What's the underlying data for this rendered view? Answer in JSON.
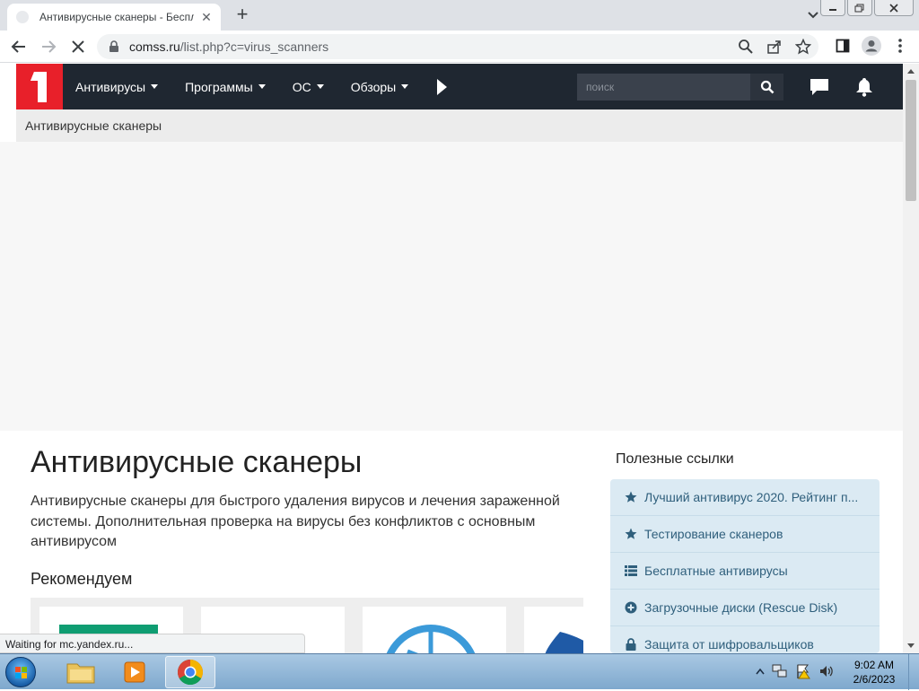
{
  "browser": {
    "tab_title": "Антивирусные сканеры - Беспл",
    "tab_close": "✕",
    "new_tab": "+",
    "url_host": "comss.ru",
    "url_path": "/list.php?c=virus_scanners"
  },
  "site": {
    "logo_text": "1",
    "nav": [
      "Антивирусы",
      "Программы",
      "ОС",
      "Обзоры"
    ],
    "search_placeholder": "поиск",
    "breadcrumb": "Антивирусные сканеры"
  },
  "content": {
    "title": "Антивирусные сканеры",
    "description": "Антивирусные сканеры для быстрого удаления вирусов и лечения зараженной системы. Дополнительная проверка на вирусы без конфликтов с основным антивирусом",
    "recommend_heading": "Рекомендуем"
  },
  "sidebar": {
    "title": "Полезные ссылки",
    "links": [
      {
        "icon": "star-icon",
        "label": "Лучший антивирус 2020. Рейтинг п..."
      },
      {
        "icon": "star-icon",
        "label": "Тестирование сканеров"
      },
      {
        "icon": "list-icon",
        "label": "Бесплатные антивирусы"
      },
      {
        "icon": "plus-circle-icon",
        "label": "Загрузочные диски (Rescue Disk)"
      },
      {
        "icon": "lock-icon",
        "label": "Защита от шифровальщиков"
      }
    ]
  },
  "status_text": "Waiting for mc.yandex.ru...",
  "taskbar": {
    "time": "9:02 AM",
    "date": "2/6/2023"
  },
  "colors": {
    "header_bg": "#1f2731",
    "logo_red": "#e8202a",
    "link_bg": "#dbeaf3",
    "link_text": "#2f5f7c"
  }
}
